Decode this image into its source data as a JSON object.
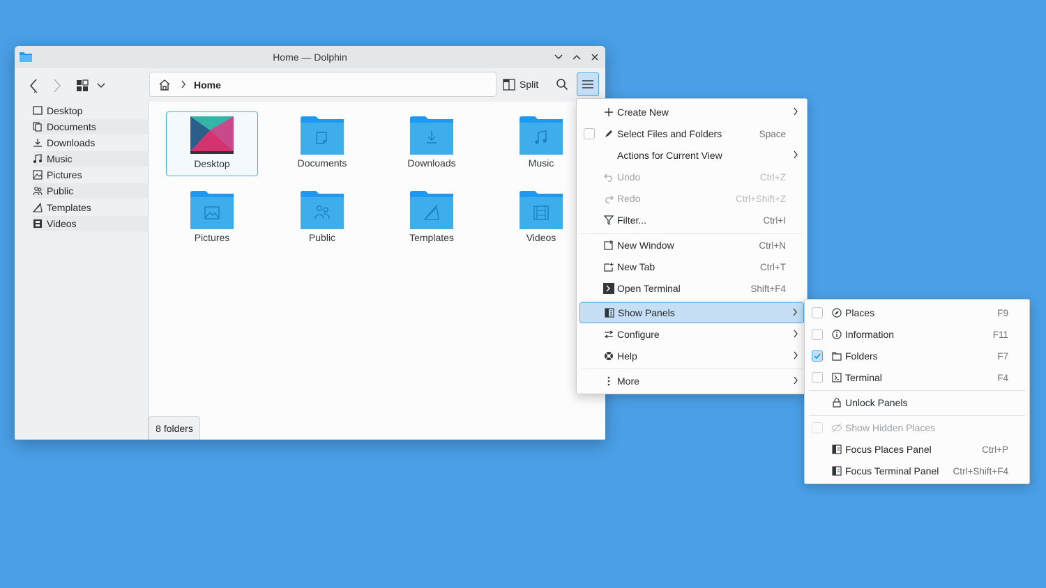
{
  "window": {
    "title": "Home — Dolphin",
    "breadcrumb_current": "Home",
    "split_label": "Split",
    "status_text": "8 folders"
  },
  "sidebar": {
    "items": [
      {
        "label": "Desktop",
        "icon": "desktop-icon"
      },
      {
        "label": "Documents",
        "icon": "documents-icon"
      },
      {
        "label": "Downloads",
        "icon": "downloads-icon"
      },
      {
        "label": "Music",
        "icon": "music-icon"
      },
      {
        "label": "Pictures",
        "icon": "pictures-icon"
      },
      {
        "label": "Public",
        "icon": "public-icon"
      },
      {
        "label": "Templates",
        "icon": "templates-icon"
      },
      {
        "label": "Videos",
        "icon": "videos-icon"
      }
    ]
  },
  "files": [
    {
      "label": "Desktop",
      "selected": true
    },
    {
      "label": "Documents"
    },
    {
      "label": "Downloads"
    },
    {
      "label": "Music"
    },
    {
      "label": "Pictures"
    },
    {
      "label": "Public"
    },
    {
      "label": "Templates"
    },
    {
      "label": "Videos"
    }
  ],
  "main_menu": {
    "items": [
      {
        "label": "Create New",
        "shortcut": ""
      },
      {
        "label": "Select Files and Folders",
        "shortcut": "Space"
      },
      {
        "label": "Actions for Current View",
        "shortcut": ""
      },
      {
        "label": "Undo",
        "shortcut": "Ctrl+Z"
      },
      {
        "label": "Redo",
        "shortcut": "Ctrl+Shift+Z"
      },
      {
        "label": "Filter...",
        "shortcut": "Ctrl+I"
      },
      {
        "label": "New Window",
        "shortcut": "Ctrl+N"
      },
      {
        "label": "New Tab",
        "shortcut": "Ctrl+T"
      },
      {
        "label": "Open Terminal",
        "shortcut": "Shift+F4"
      },
      {
        "label": "Show Panels",
        "shortcut": ""
      },
      {
        "label": "Configure",
        "shortcut": ""
      },
      {
        "label": "Help",
        "shortcut": ""
      },
      {
        "label": "More",
        "shortcut": ""
      }
    ]
  },
  "panels_menu": {
    "items": [
      {
        "label": "Places",
        "shortcut": "F9",
        "checked": false
      },
      {
        "label": "Information",
        "shortcut": "F11",
        "checked": false
      },
      {
        "label": "Folders",
        "shortcut": "F7",
        "checked": true
      },
      {
        "label": "Terminal",
        "shortcut": "F4",
        "checked": false
      },
      {
        "label": "Unlock Panels",
        "shortcut": ""
      },
      {
        "label": "Show Hidden Places",
        "shortcut": ""
      },
      {
        "label": "Focus Places Panel",
        "shortcut": "Ctrl+P"
      },
      {
        "label": "Focus Terminal Panel",
        "shortcut": "Ctrl+Shift+F4"
      }
    ]
  },
  "colors": {
    "desktop_bg": "#4a9fe6",
    "accent": "#3daee9",
    "folder": "#3daee9",
    "folder_dark": "#1d99f3"
  }
}
